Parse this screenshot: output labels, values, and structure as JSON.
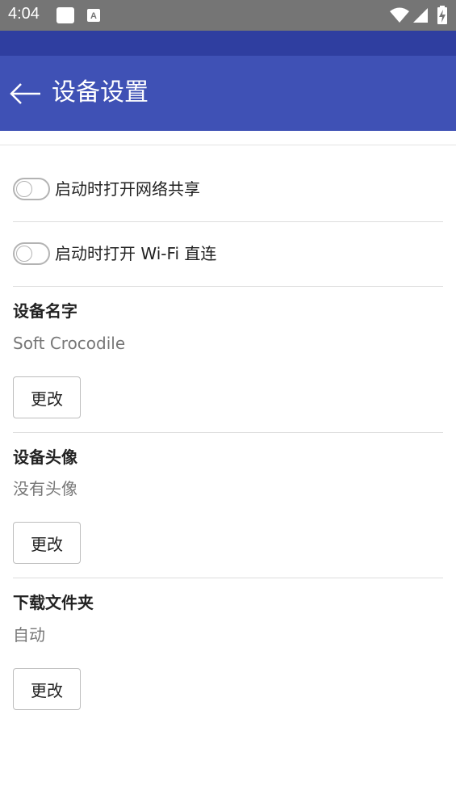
{
  "status_bar": {
    "time": "4:04",
    "icons": [
      "square-notification-icon",
      "font-a-icon",
      "wifi-icon",
      "cell-signal-icon",
      "battery-charging-icon"
    ]
  },
  "toolbar": {
    "title": "设备设置",
    "back_icon": "arrow-left-icon"
  },
  "settings": {
    "hotspot_label": "启动时打开网络共享",
    "hotspot_on": false,
    "wifi_direct_label": "启动时打开 Wi-Fi 直连",
    "wifi_direct_on": false,
    "device_name": {
      "title": "设备名字",
      "value": "Soft Crocodile",
      "button": "更改"
    },
    "device_avatar": {
      "title": "设备头像",
      "value": "没有头像",
      "button": "更改"
    },
    "download_folder": {
      "title": "下载文件夹",
      "value": "自动",
      "button": "更改"
    }
  },
  "colors": {
    "status_bar": "#757575",
    "app_strip": "#2f3ea0",
    "toolbar": "#3f51b5",
    "switch_off": "#b3b3b3"
  }
}
